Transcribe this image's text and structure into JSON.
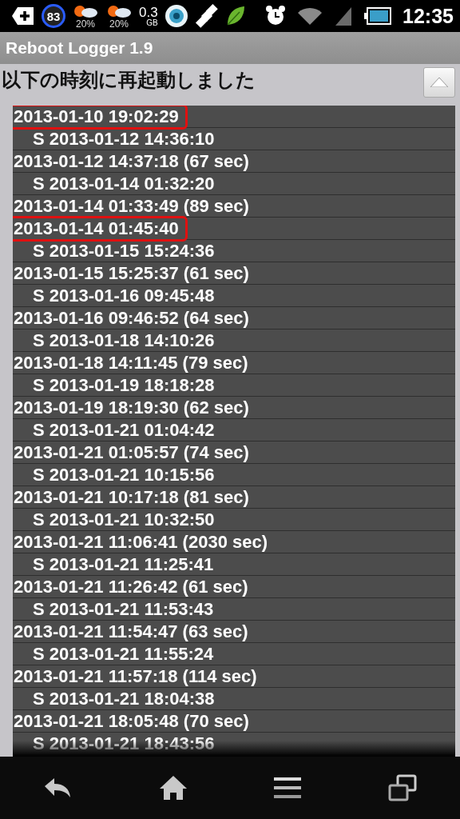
{
  "status_bar": {
    "notification_badge": "83",
    "weather": [
      {
        "percent": "20%"
      },
      {
        "percent": "20%"
      }
    ],
    "data_usage": {
      "amount": "0.3",
      "unit": "GB"
    },
    "time": "12:35"
  },
  "app_bar": {
    "title": "Reboot Logger 1.9"
  },
  "heading": "以下の時刻に再起動しました",
  "log": [
    {
      "kind": "reboot",
      "text": "2013-01-10 19:02:29",
      "highlighted": true
    },
    {
      "kind": "start",
      "text": "S 2013-01-12 14:36:10",
      "highlighted": false
    },
    {
      "kind": "reboot",
      "text": "2013-01-12 14:37:18 (67 sec)",
      "highlighted": false
    },
    {
      "kind": "start",
      "text": "S 2013-01-14 01:32:20",
      "highlighted": false
    },
    {
      "kind": "reboot",
      "text": "2013-01-14 01:33:49 (89 sec)",
      "highlighted": false
    },
    {
      "kind": "reboot",
      "text": "2013-01-14 01:45:40",
      "highlighted": true
    },
    {
      "kind": "start",
      "text": "S 2013-01-15 15:24:36",
      "highlighted": false
    },
    {
      "kind": "reboot",
      "text": "2013-01-15 15:25:37 (61 sec)",
      "highlighted": false
    },
    {
      "kind": "start",
      "text": "S 2013-01-16 09:45:48",
      "highlighted": false
    },
    {
      "kind": "reboot",
      "text": "2013-01-16 09:46:52 (64 sec)",
      "highlighted": false
    },
    {
      "kind": "start",
      "text": "S 2013-01-18 14:10:26",
      "highlighted": false
    },
    {
      "kind": "reboot",
      "text": "2013-01-18 14:11:45 (79 sec)",
      "highlighted": false
    },
    {
      "kind": "start",
      "text": "S 2013-01-19 18:18:28",
      "highlighted": false
    },
    {
      "kind": "reboot",
      "text": "2013-01-19 18:19:30 (62 sec)",
      "highlighted": false
    },
    {
      "kind": "start",
      "text": "S 2013-01-21 01:04:42",
      "highlighted": false
    },
    {
      "kind": "reboot",
      "text": "2013-01-21 01:05:57 (74 sec)",
      "highlighted": false
    },
    {
      "kind": "start",
      "text": "S 2013-01-21 10:15:56",
      "highlighted": false
    },
    {
      "kind": "reboot",
      "text": "2013-01-21 10:17:18 (81 sec)",
      "highlighted": false
    },
    {
      "kind": "start",
      "text": "S 2013-01-21 10:32:50",
      "highlighted": false
    },
    {
      "kind": "reboot",
      "text": "2013-01-21 11:06:41 (2030 sec)",
      "highlighted": false
    },
    {
      "kind": "start",
      "text": "S 2013-01-21 11:25:41",
      "highlighted": false
    },
    {
      "kind": "reboot",
      "text": "2013-01-21 11:26:42 (61 sec)",
      "highlighted": false
    },
    {
      "kind": "start",
      "text": "S 2013-01-21 11:53:43",
      "highlighted": false
    },
    {
      "kind": "reboot",
      "text": "2013-01-21 11:54:47 (63 sec)",
      "highlighted": false
    },
    {
      "kind": "start",
      "text": "S 2013-01-21 11:55:24",
      "highlighted": false
    },
    {
      "kind": "reboot",
      "text": "2013-01-21 11:57:18 (114 sec)",
      "highlighted": false
    },
    {
      "kind": "start",
      "text": "S 2013-01-21 18:04:38",
      "highlighted": false
    },
    {
      "kind": "reboot",
      "text": "2013-01-21 18:05:48 (70 sec)",
      "highlighted": false
    },
    {
      "kind": "start",
      "text": "S 2013-01-21 18:43:56",
      "highlighted": false
    }
  ]
}
